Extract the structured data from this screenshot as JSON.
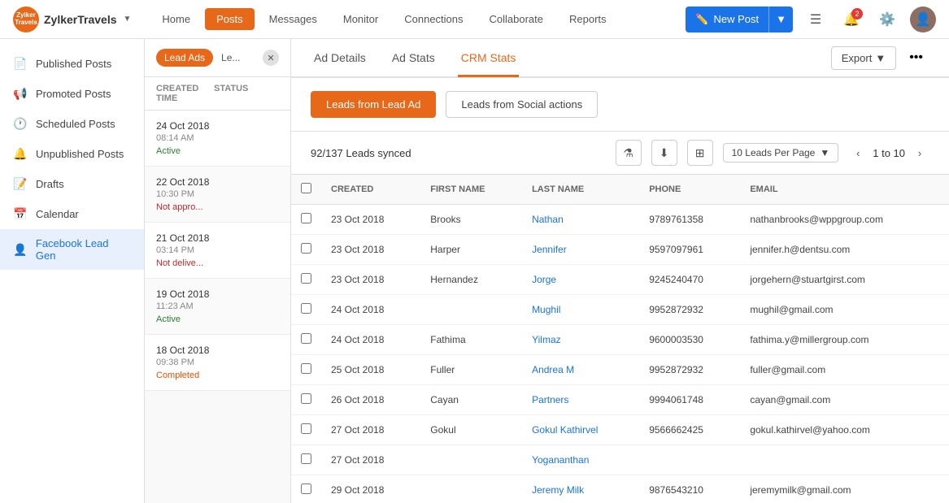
{
  "app": {
    "brand": "ZylkerTravels",
    "logoText": "Zyiker\nTravels"
  },
  "topNav": {
    "items": [
      {
        "label": "Home",
        "active": false
      },
      {
        "label": "Posts",
        "active": true
      },
      {
        "label": "Messages",
        "active": false
      },
      {
        "label": "Monitor",
        "active": false
      },
      {
        "label": "Connections",
        "active": false
      },
      {
        "label": "Collaborate",
        "active": false
      },
      {
        "label": "Reports",
        "active": false
      }
    ],
    "newPostLabel": "New Post",
    "notifCount": "2"
  },
  "sidebar": {
    "items": [
      {
        "label": "Published Posts",
        "icon": "📄",
        "active": false
      },
      {
        "label": "Promoted Posts",
        "icon": "📢",
        "active": false
      },
      {
        "label": "Scheduled Posts",
        "icon": "🕐",
        "active": false
      },
      {
        "label": "Unpublished Posts",
        "icon": "🔔",
        "active": false
      },
      {
        "label": "Drafts",
        "icon": "📝",
        "active": false
      },
      {
        "label": "Calendar",
        "icon": "📅",
        "active": false
      },
      {
        "label": "Facebook Lead Gen",
        "icon": "👤",
        "active": true
      }
    ]
  },
  "centerPanel": {
    "tabs": [
      {
        "label": "Lead Ads",
        "active": true
      },
      {
        "label": "Le...",
        "active": false
      }
    ],
    "columnHeaders": [
      "CREATED TIME",
      "STATUS"
    ],
    "posts": [
      {
        "date": "24 Oct 2018",
        "time": "08:14 AM",
        "status": "Active",
        "statusClass": "status-active"
      },
      {
        "date": "22 Oct 2018",
        "time": "10:30 PM",
        "status": "Not appro...",
        "statusClass": "status-not-approved"
      },
      {
        "date": "21 Oct 2018",
        "time": "03:14 PM",
        "status": "Not delive...",
        "statusClass": "status-not-delivered"
      },
      {
        "date": "19 Oct 2018",
        "time": "11:23 AM",
        "status": "Active",
        "statusClass": "status-active"
      },
      {
        "date": "18 Oct 2018",
        "time": "09:38 PM",
        "status": "Completed",
        "statusClass": "status-completed"
      }
    ]
  },
  "contentTabs": [
    {
      "label": "Ad Details",
      "active": false
    },
    {
      "label": "Ad Stats",
      "active": false
    },
    {
      "label": "CRM Stats",
      "active": true
    }
  ],
  "export": {
    "label": "Export",
    "dotsLabel": "•••"
  },
  "leadButtons": [
    {
      "label": "Leads from Lead Ad",
      "active": true
    },
    {
      "label": "Leads from Social actions",
      "active": false
    }
  ],
  "leadsToolbar": {
    "synced": "92/137 Leads synced",
    "perPage": "10 Leads Per Page",
    "pagination": "1 to 10"
  },
  "table": {
    "headers": [
      "CREATED",
      "FIRST NAME",
      "LAST NAME",
      "PHONE",
      "EMAIL"
    ],
    "rows": [
      {
        "created": "23 Oct 2018",
        "firstName": "Brooks",
        "lastName": "Nathan",
        "phone": "9789761358",
        "email": "nathanbrooks@wppgroup.com"
      },
      {
        "created": "23 Oct 2018",
        "firstName": "Harper",
        "lastName": "Jennifer",
        "phone": "9597097961",
        "email": "jennifer.h@dentsu.com"
      },
      {
        "created": "23 Oct 2018",
        "firstName": "Hernandez",
        "lastName": "Jorge",
        "phone": "9245240470",
        "email": "jorgehern@stuartgirst.com"
      },
      {
        "created": "24 Oct 2018",
        "firstName": "",
        "lastName": "Mughil",
        "phone": "9952872932",
        "email": "mughil@gmail.com"
      },
      {
        "created": "24 Oct 2018",
        "firstName": "Fathima",
        "lastName": "Yilmaz",
        "phone": "9600003530",
        "email": "fathima.y@millergroup.com"
      },
      {
        "created": "25 Oct 2018",
        "firstName": "Fuller",
        "lastName": "Andrea M",
        "phone": "9952872932",
        "email": "fuller@gmail.com"
      },
      {
        "created": "26 Oct 2018",
        "firstName": "Cayan",
        "lastName": "Partners",
        "phone": "9994061748",
        "email": "cayan@gmail.com"
      },
      {
        "created": "27 Oct 2018",
        "firstName": "Gokul",
        "lastName": "Gokul Kathirvel",
        "phone": "9566662425",
        "email": "gokul.kathirvel@yahoo.com"
      },
      {
        "created": "27 Oct 2018",
        "firstName": "",
        "lastName": "Yogananthan",
        "phone": "",
        "email": ""
      },
      {
        "created": "29 Oct 2018",
        "firstName": "",
        "lastName": "Jeremy Milk",
        "phone": "9876543210",
        "email": "jeremymilk@gmail.com"
      }
    ]
  }
}
